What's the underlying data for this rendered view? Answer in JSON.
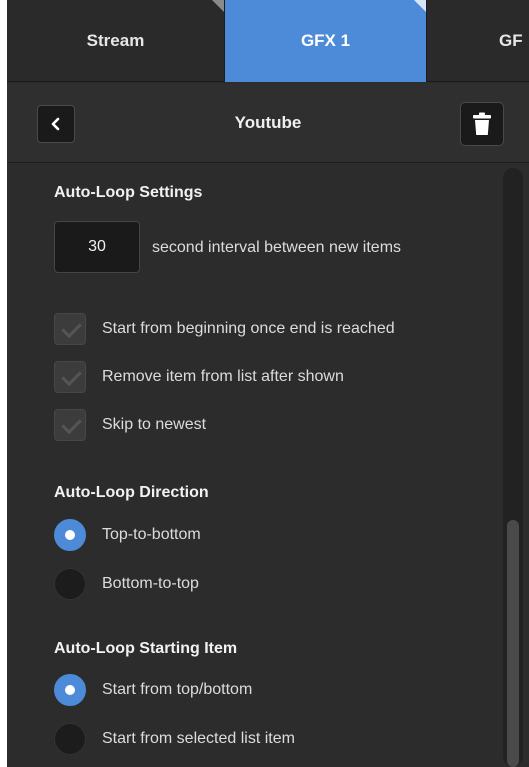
{
  "tabs": [
    {
      "label": "Stream",
      "active": false
    },
    {
      "label": "GFX 1",
      "active": true
    },
    {
      "label": "GF",
      "active": false
    }
  ],
  "header": {
    "back_icon": "chevron-left-icon",
    "title": "Youtube",
    "delete_icon": "trash-icon"
  },
  "settings": {
    "title": "Auto-Loop Settings",
    "interval_value": "30",
    "interval_label": "second interval between new items",
    "options": [
      {
        "label": "Start from beginning once end is reached",
        "checked": true
      },
      {
        "label": "Remove item from list after shown",
        "checked": true
      },
      {
        "label": "Skip to newest",
        "checked": true
      }
    ]
  },
  "direction": {
    "title": "Auto-Loop Direction",
    "options": [
      {
        "label": "Top-to-bottom",
        "selected": true
      },
      {
        "label": "Bottom-to-top",
        "selected": false
      }
    ]
  },
  "starting_item": {
    "title": "Auto-Loop Starting Item",
    "options": [
      {
        "label": "Start from top/bottom",
        "selected": true
      },
      {
        "label": "Start from selected list item",
        "selected": false
      }
    ]
  },
  "colors": {
    "accent": "#4d8bd8",
    "panel": "#2c2c2c"
  }
}
